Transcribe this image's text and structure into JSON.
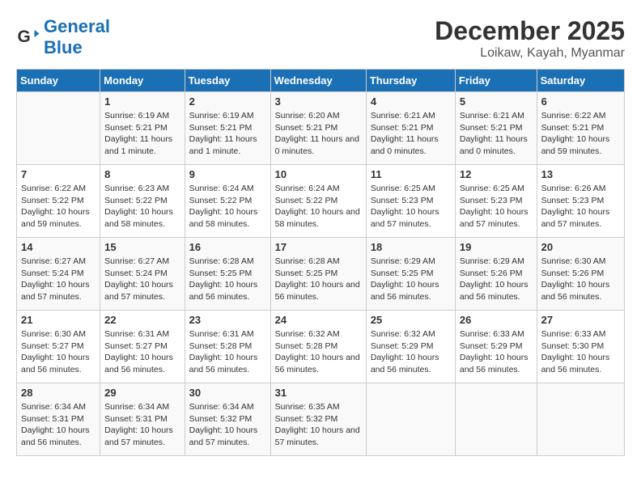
{
  "header": {
    "logo_line1": "General",
    "logo_line2": "Blue",
    "month": "December 2025",
    "location": "Loikaw, Kayah, Myanmar"
  },
  "days_of_week": [
    "Sunday",
    "Monday",
    "Tuesday",
    "Wednesday",
    "Thursday",
    "Friday",
    "Saturday"
  ],
  "weeks": [
    [
      {
        "num": "",
        "sunrise": "",
        "sunset": "",
        "daylight": ""
      },
      {
        "num": "1",
        "sunrise": "Sunrise: 6:19 AM",
        "sunset": "Sunset: 5:21 PM",
        "daylight": "Daylight: 11 hours and 1 minute."
      },
      {
        "num": "2",
        "sunrise": "Sunrise: 6:19 AM",
        "sunset": "Sunset: 5:21 PM",
        "daylight": "Daylight: 11 hours and 1 minute."
      },
      {
        "num": "3",
        "sunrise": "Sunrise: 6:20 AM",
        "sunset": "Sunset: 5:21 PM",
        "daylight": "Daylight: 11 hours and 0 minutes."
      },
      {
        "num": "4",
        "sunrise": "Sunrise: 6:21 AM",
        "sunset": "Sunset: 5:21 PM",
        "daylight": "Daylight: 11 hours and 0 minutes."
      },
      {
        "num": "5",
        "sunrise": "Sunrise: 6:21 AM",
        "sunset": "Sunset: 5:21 PM",
        "daylight": "Daylight: 11 hours and 0 minutes."
      },
      {
        "num": "6",
        "sunrise": "Sunrise: 6:22 AM",
        "sunset": "Sunset: 5:21 PM",
        "daylight": "Daylight: 10 hours and 59 minutes."
      }
    ],
    [
      {
        "num": "7",
        "sunrise": "Sunrise: 6:22 AM",
        "sunset": "Sunset: 5:22 PM",
        "daylight": "Daylight: 10 hours and 59 minutes."
      },
      {
        "num": "8",
        "sunrise": "Sunrise: 6:23 AM",
        "sunset": "Sunset: 5:22 PM",
        "daylight": "Daylight: 10 hours and 58 minutes."
      },
      {
        "num": "9",
        "sunrise": "Sunrise: 6:24 AM",
        "sunset": "Sunset: 5:22 PM",
        "daylight": "Daylight: 10 hours and 58 minutes."
      },
      {
        "num": "10",
        "sunrise": "Sunrise: 6:24 AM",
        "sunset": "Sunset: 5:22 PM",
        "daylight": "Daylight: 10 hours and 58 minutes."
      },
      {
        "num": "11",
        "sunrise": "Sunrise: 6:25 AM",
        "sunset": "Sunset: 5:23 PM",
        "daylight": "Daylight: 10 hours and 57 minutes."
      },
      {
        "num": "12",
        "sunrise": "Sunrise: 6:25 AM",
        "sunset": "Sunset: 5:23 PM",
        "daylight": "Daylight: 10 hours and 57 minutes."
      },
      {
        "num": "13",
        "sunrise": "Sunrise: 6:26 AM",
        "sunset": "Sunset: 5:23 PM",
        "daylight": "Daylight: 10 hours and 57 minutes."
      }
    ],
    [
      {
        "num": "14",
        "sunrise": "Sunrise: 6:27 AM",
        "sunset": "Sunset: 5:24 PM",
        "daylight": "Daylight: 10 hours and 57 minutes."
      },
      {
        "num": "15",
        "sunrise": "Sunrise: 6:27 AM",
        "sunset": "Sunset: 5:24 PM",
        "daylight": "Daylight: 10 hours and 57 minutes."
      },
      {
        "num": "16",
        "sunrise": "Sunrise: 6:28 AM",
        "sunset": "Sunset: 5:25 PM",
        "daylight": "Daylight: 10 hours and 56 minutes."
      },
      {
        "num": "17",
        "sunrise": "Sunrise: 6:28 AM",
        "sunset": "Sunset: 5:25 PM",
        "daylight": "Daylight: 10 hours and 56 minutes."
      },
      {
        "num": "18",
        "sunrise": "Sunrise: 6:29 AM",
        "sunset": "Sunset: 5:25 PM",
        "daylight": "Daylight: 10 hours and 56 minutes."
      },
      {
        "num": "19",
        "sunrise": "Sunrise: 6:29 AM",
        "sunset": "Sunset: 5:26 PM",
        "daylight": "Daylight: 10 hours and 56 minutes."
      },
      {
        "num": "20",
        "sunrise": "Sunrise: 6:30 AM",
        "sunset": "Sunset: 5:26 PM",
        "daylight": "Daylight: 10 hours and 56 minutes."
      }
    ],
    [
      {
        "num": "21",
        "sunrise": "Sunrise: 6:30 AM",
        "sunset": "Sunset: 5:27 PM",
        "daylight": "Daylight: 10 hours and 56 minutes."
      },
      {
        "num": "22",
        "sunrise": "Sunrise: 6:31 AM",
        "sunset": "Sunset: 5:27 PM",
        "daylight": "Daylight: 10 hours and 56 minutes."
      },
      {
        "num": "23",
        "sunrise": "Sunrise: 6:31 AM",
        "sunset": "Sunset: 5:28 PM",
        "daylight": "Daylight: 10 hours and 56 minutes."
      },
      {
        "num": "24",
        "sunrise": "Sunrise: 6:32 AM",
        "sunset": "Sunset: 5:28 PM",
        "daylight": "Daylight: 10 hours and 56 minutes."
      },
      {
        "num": "25",
        "sunrise": "Sunrise: 6:32 AM",
        "sunset": "Sunset: 5:29 PM",
        "daylight": "Daylight: 10 hours and 56 minutes."
      },
      {
        "num": "26",
        "sunrise": "Sunrise: 6:33 AM",
        "sunset": "Sunset: 5:29 PM",
        "daylight": "Daylight: 10 hours and 56 minutes."
      },
      {
        "num": "27",
        "sunrise": "Sunrise: 6:33 AM",
        "sunset": "Sunset: 5:30 PM",
        "daylight": "Daylight: 10 hours and 56 minutes."
      }
    ],
    [
      {
        "num": "28",
        "sunrise": "Sunrise: 6:34 AM",
        "sunset": "Sunset: 5:31 PM",
        "daylight": "Daylight: 10 hours and 56 minutes."
      },
      {
        "num": "29",
        "sunrise": "Sunrise: 6:34 AM",
        "sunset": "Sunset: 5:31 PM",
        "daylight": "Daylight: 10 hours and 57 minutes."
      },
      {
        "num": "30",
        "sunrise": "Sunrise: 6:34 AM",
        "sunset": "Sunset: 5:32 PM",
        "daylight": "Daylight: 10 hours and 57 minutes."
      },
      {
        "num": "31",
        "sunrise": "Sunrise: 6:35 AM",
        "sunset": "Sunset: 5:32 PM",
        "daylight": "Daylight: 10 hours and 57 minutes."
      },
      {
        "num": "",
        "sunrise": "",
        "sunset": "",
        "daylight": ""
      },
      {
        "num": "",
        "sunrise": "",
        "sunset": "",
        "daylight": ""
      },
      {
        "num": "",
        "sunrise": "",
        "sunset": "",
        "daylight": ""
      }
    ]
  ]
}
